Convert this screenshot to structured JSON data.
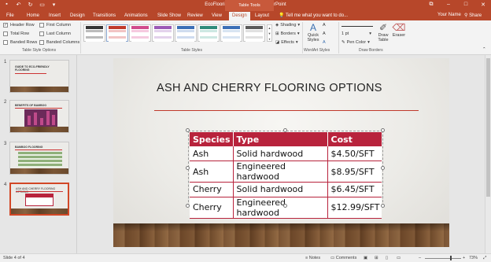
{
  "window": {
    "title": "EcoFlooring Presentation - PowerPoint",
    "context_tab_group": "Table Tools",
    "user_name": "Your Name",
    "share_label": "Share",
    "tell_me": "Tell me what you want to do..."
  },
  "tabs": [
    "File",
    "Home",
    "Insert",
    "Design",
    "Transitions",
    "Animations",
    "Slide Show",
    "Review",
    "View",
    "Design",
    "Layout"
  ],
  "active_tab_index": 9,
  "ribbon": {
    "table_style_options": {
      "label": "Table Style Options",
      "items": [
        {
          "label": "Header Row",
          "checked": true
        },
        {
          "label": "First Column",
          "checked": false
        },
        {
          "label": "Total Row",
          "checked": false
        },
        {
          "label": "Last Column",
          "checked": false
        },
        {
          "label": "Banded Rows",
          "checked": false
        },
        {
          "label": "Banded Columns",
          "checked": false
        }
      ]
    },
    "table_styles": {
      "label": "Table Styles",
      "shading": "Shading",
      "borders": "Borders",
      "effects": "Effects"
    },
    "wordart": {
      "label": "WordArt Styles",
      "quick_styles": "Quick Styles"
    },
    "draw_borders": {
      "label": "Draw Borders",
      "pen_weight": "1 pt",
      "pen_color": "Pen Color",
      "draw_table": "Draw Table",
      "eraser": "Eraser"
    }
  },
  "thumbnails": [
    {
      "number": "1",
      "title": "GUIDE TO ECO-FRIENDLY FLOORING"
    },
    {
      "number": "2",
      "title": "BENEFITS OF BAMBOO"
    },
    {
      "number": "3",
      "title": "BAMBOO FLOORING"
    },
    {
      "number": "4",
      "title": "ASH AND CHERRY FLOORING OPTIONS"
    }
  ],
  "slide": {
    "title": "ASH AND CHERRY FLOORING OPTIONS",
    "table": {
      "headers": [
        "Species",
        "Type",
        "Cost"
      ],
      "rows": [
        [
          "Ash",
          "Solid hardwood",
          "$4.50/SFT"
        ],
        [
          "Ash",
          "Engineered hardwood",
          "$8.95/SFT"
        ],
        [
          "Cherry",
          "Solid hardwood",
          "$6.45/SFT"
        ],
        [
          "Cherry",
          "Engineered hardwood",
          "$12.99/SFT"
        ]
      ]
    }
  },
  "statusbar": {
    "slide_info": "Slide 4 of 4",
    "notes": "Notes",
    "comments": "Comments",
    "zoom": "73%"
  },
  "colors": {
    "accent": "#b7472a",
    "table_header": "#b8233c"
  }
}
